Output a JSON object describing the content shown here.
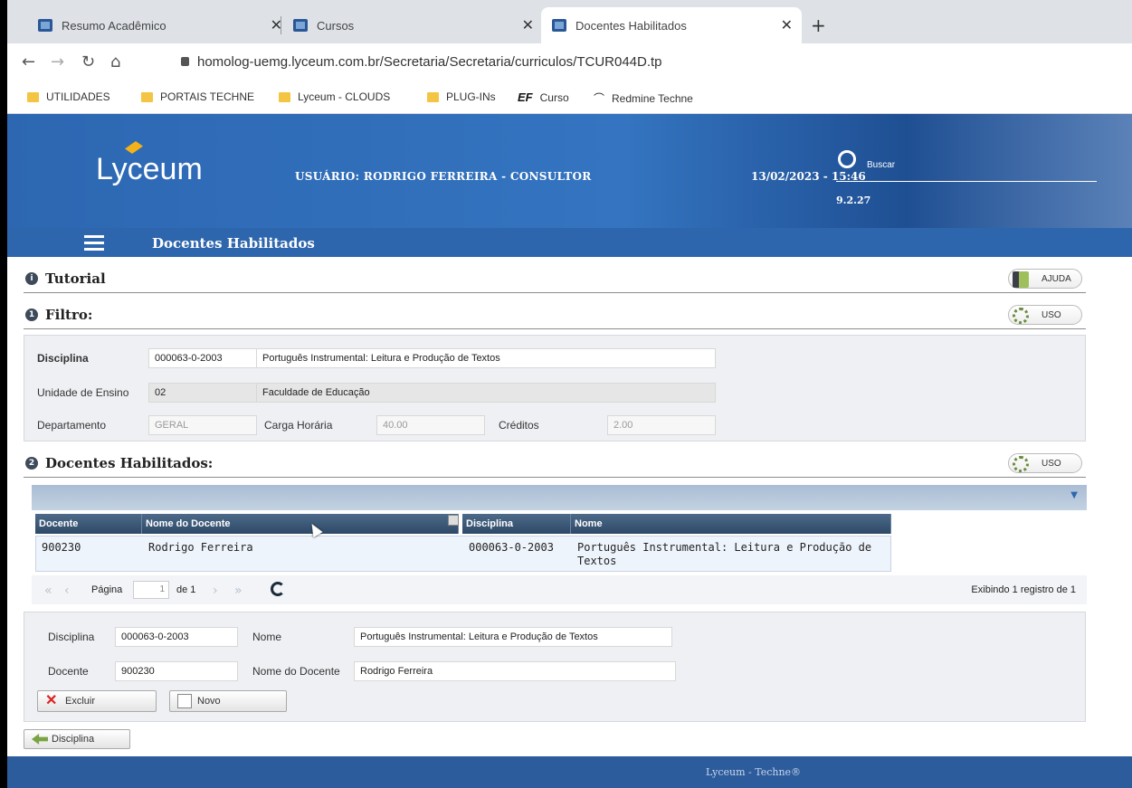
{
  "browser": {
    "tabs": [
      {
        "label": "Resumo Acadêmico",
        "active": false
      },
      {
        "label": "Cursos",
        "active": false
      },
      {
        "label": "Docentes Habilitados",
        "active": true
      }
    ],
    "url": "homolog-uemg.lyceum.com.br/Secretaria/Secretaria/curriculos/TCUR044D.tp",
    "bookmarks": [
      "UTILIDADES",
      "PORTAIS TECHNE",
      "Lyceum - CLOUDS",
      "PLUG-INs",
      "EF",
      "Curso",
      "Redmine Techne"
    ]
  },
  "header": {
    "logo": "Lyceum",
    "user": "USUÁRIO: RODRIGO FERREIRA - CONSULTOR",
    "datetime": "13/02/2023 - 15:46",
    "search_label": "Buscar",
    "version": "9.2.27"
  },
  "subheader": {
    "title": "Docentes Habilitados"
  },
  "tutorial": {
    "title": "Tutorial",
    "help_label": "AJUDA"
  },
  "filtro": {
    "title": "Filtro:",
    "uso_label": "USO",
    "disciplina_label": "Disciplina",
    "disciplina_code": "000063-0-2003",
    "disciplina_name": "Português Instrumental: Leitura e Produção de Textos",
    "unidade_label": "Unidade de Ensino",
    "unidade_code": "02",
    "unidade_name": "Faculdade de Educação",
    "departamento_label": "Departamento",
    "departamento_value": "GERAL",
    "carga_label": "Carga Horária",
    "carga_value": "40.00",
    "creditos_label": "Créditos",
    "creditos_value": "2.00"
  },
  "docentes": {
    "title": "Docentes Habilitados:",
    "uso_label": "USO",
    "columns": [
      "Docente",
      "Nome do Docente",
      "Disciplina",
      "Nome"
    ],
    "rows": [
      {
        "docente": "900230",
        "nome_docente": "Rodrigo Ferreira",
        "disciplina": "000063-0-2003",
        "nome_line1": "Português Instrumental: Leitura e Produção de",
        "nome_line2": "Textos"
      }
    ],
    "pager": {
      "page_label": "Página",
      "page_value": "1",
      "of_label": "de 1",
      "status": "Exibindo 1 registro de 1"
    }
  },
  "detail": {
    "disciplina_label": "Disciplina",
    "disciplina_value": "000063-0-2003",
    "nome_label": "Nome",
    "nome_value": "Português Instrumental: Leitura e Produção de Textos",
    "docente_label": "Docente",
    "docente_value": "900230",
    "nome_docente_label": "Nome do Docente",
    "nome_docente_value": "Rodrigo Ferreira",
    "excluir_label": "Excluir",
    "novo_label": "Novo"
  },
  "bottom": {
    "disciplina_button": "Disciplina"
  },
  "footer": {
    "text": "Lyceum - Techne®"
  }
}
